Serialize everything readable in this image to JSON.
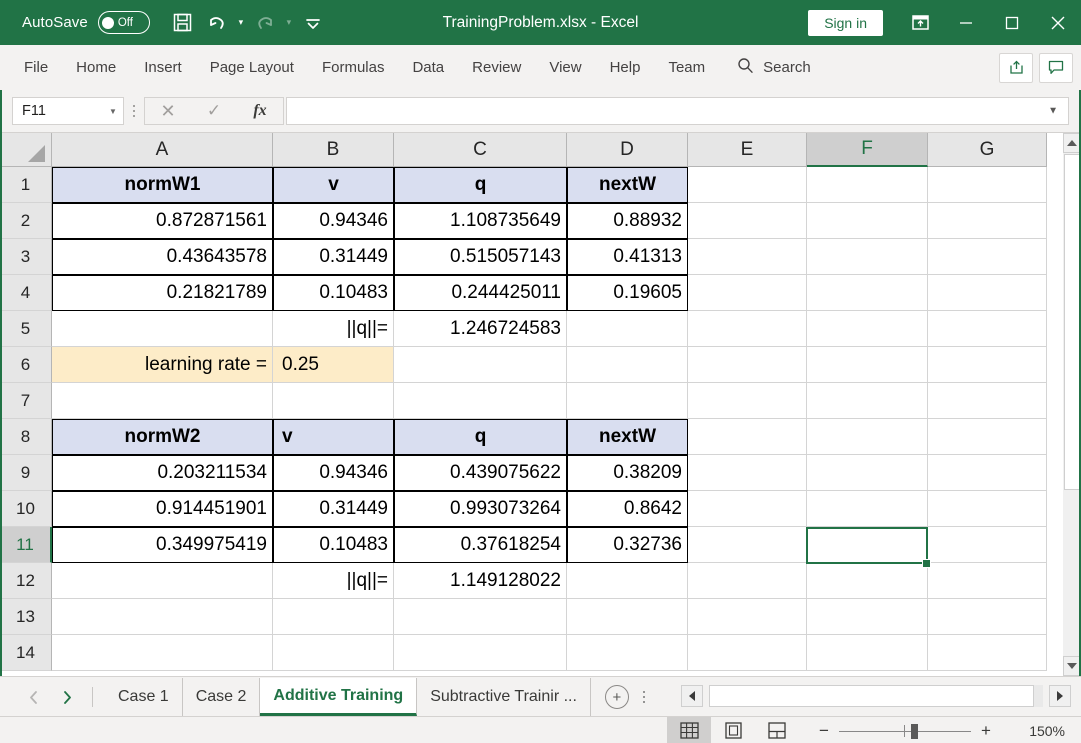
{
  "titlebar": {
    "autosave_label": "AutoSave",
    "autosave_state": "Off",
    "save_icon": "save-icon",
    "undo_icon": "undo-icon",
    "redo_icon": "redo-icon",
    "customize_icon": "customize-quick-access-toolbar-icon",
    "document_title": "TrainingProblem.xlsx  -  Excel",
    "signin_label": "Sign in",
    "ribbon_display_icon": "ribbon-display-options-icon",
    "minimize_icon": "minimize-icon",
    "maximize_icon": "maximize-icon",
    "close_icon": "close-icon"
  },
  "ribbon": {
    "tabs": [
      {
        "label": "File"
      },
      {
        "label": "Home"
      },
      {
        "label": "Insert"
      },
      {
        "label": "Page Layout"
      },
      {
        "label": "Formulas"
      },
      {
        "label": "Data"
      },
      {
        "label": "Review"
      },
      {
        "label": "View"
      },
      {
        "label": "Help"
      },
      {
        "label": "Team"
      }
    ],
    "search_label": "Search",
    "search_icon": "search-icon",
    "share_icon": "share-icon",
    "comments_icon": "comments-icon"
  },
  "formulabar": {
    "namebox_value": "F11",
    "namebox_caret": "chevron-down-icon",
    "cancel_icon": "cancel-icon",
    "enter_icon": "enter-icon",
    "insert_function_icon": "fx",
    "formula_value": "",
    "expand_caret": "chevron-down-icon"
  },
  "grid": {
    "columns": [
      "A",
      "B",
      "C",
      "D",
      "E",
      "F",
      "G"
    ],
    "selected_column": "F",
    "rows": [
      "1",
      "2",
      "3",
      "4",
      "5",
      "6",
      "7",
      "8",
      "9",
      "10",
      "11",
      "12",
      "13",
      "14"
    ],
    "selected_row": "11",
    "selected_cell": "F11",
    "cells": {
      "A1": "normW1",
      "B1": "v",
      "C1": "q",
      "D1": "nextW",
      "A2": "0.872871561",
      "B2": "0.94346",
      "C2": "1.108735649",
      "D2": "0.88932",
      "A3": "0.43643578",
      "B3": "0.31449",
      "C3": "0.515057143",
      "D3": "0.41313",
      "A4": "0.21821789",
      "B4": "0.10483",
      "C4": "0.244425011",
      "D4": "0.19605",
      "B5": "||q||=",
      "C5": "1.246724583",
      "A6": "learning rate =",
      "B6": "0.25",
      "A8": "normW2",
      "B8": "v",
      "C8": "q",
      "D8": "nextW",
      "A9": "0.203211534",
      "B9": "0.94346",
      "C9": "0.439075622",
      "D9": "0.38209",
      "A10": "0.914451901",
      "B10": "0.31449",
      "C10": "0.993073264",
      "D10": "0.8642",
      "A11": "0.349975419",
      "B11": "0.10483",
      "C11": "0.37618254",
      "D11": "0.32736",
      "B12": "||q||=",
      "C12": "1.149128022"
    }
  },
  "sheettabs": {
    "prev_icon": "previous-sheet-icon",
    "next_icon": "next-sheet-icon",
    "tabs": [
      {
        "label": "Case 1",
        "active": false
      },
      {
        "label": "Case 2",
        "active": false
      },
      {
        "label": "Additive Training",
        "active": true
      },
      {
        "label": "Subtractive Trainir ...",
        "active": false
      }
    ],
    "add_sheet_label": "+",
    "all_sheets_icon": "all-sheets-icon",
    "hscroll_left_icon": "scroll-left-icon",
    "hscroll_right_icon": "scroll-right-icon"
  },
  "statusbar": {
    "normal_view_icon": "normal-view-icon",
    "page_layout_icon": "page-layout-view-icon",
    "page_break_icon": "page-break-preview-icon",
    "zoom_out_label": "−",
    "zoom_in_label": "+",
    "zoom_level": "150%"
  },
  "colors": {
    "brand_green": "#217346",
    "header_fill": "#d9def0",
    "highlight_fill": "#fdecc8",
    "selection_green": "#217346"
  }
}
